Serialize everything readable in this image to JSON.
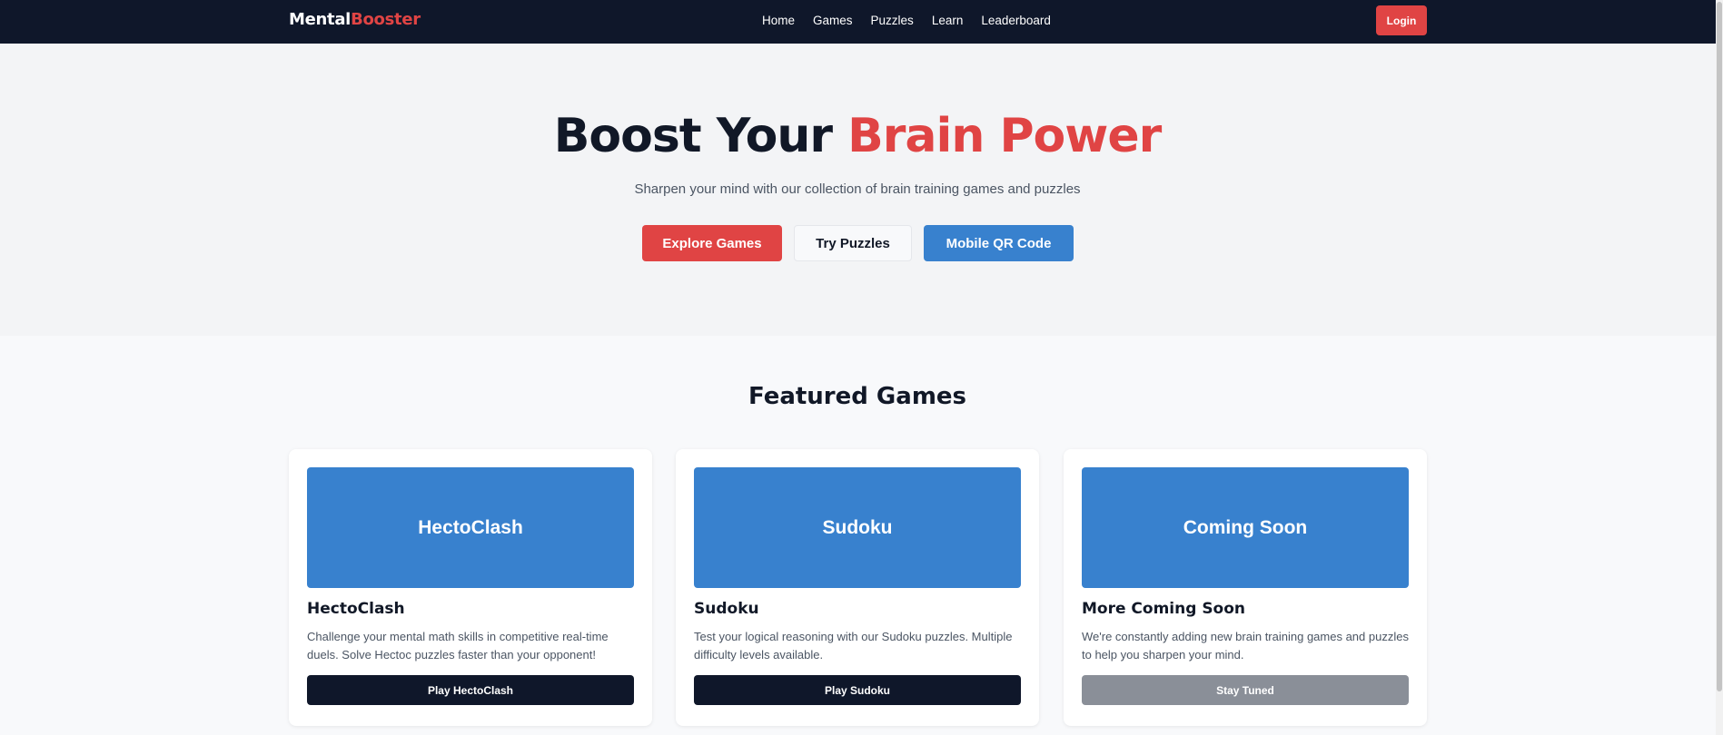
{
  "brand": {
    "part1": "Mental",
    "part2": "Booster"
  },
  "nav": {
    "items": [
      "Home",
      "Games",
      "Puzzles",
      "Learn",
      "Leaderboard"
    ],
    "login": "Login"
  },
  "hero": {
    "title_part1": "Boost Your ",
    "title_part2": "Brain Power",
    "subtitle": "Sharpen your mind with our collection of brain training games and puzzles",
    "buttons": {
      "explore": "Explore Games",
      "puzzles": "Try Puzzles",
      "qr": "Mobile QR Code"
    }
  },
  "featured": {
    "heading": "Featured Games",
    "cards": [
      {
        "banner": "HectoClash",
        "title": "HectoClash",
        "desc": "Challenge your mental math skills in competitive real-time duels. Solve Hectoc puzzles faster than your opponent!",
        "action": "Play HectoClash"
      },
      {
        "banner": "Sudoku",
        "title": "Sudoku",
        "desc": "Test your logical reasoning with our Sudoku puzzles. Multiple difficulty levels available.",
        "action": "Play Sudoku"
      },
      {
        "banner": "Coming Soon",
        "title": "More Coming Soon",
        "desc": "We're constantly adding new brain training games and puzzles to help you sharpen your mind.",
        "action": "Stay Tuned"
      }
    ]
  },
  "colors": {
    "navbar": "#0f172a",
    "accent_red": "#e04444",
    "accent_blue": "#3881ce",
    "muted_button": "#8a8f98"
  }
}
